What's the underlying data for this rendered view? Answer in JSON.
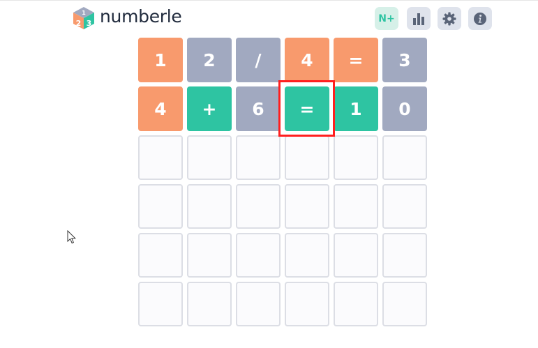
{
  "header": {
    "brand": "numberle",
    "logo_digits": [
      "1",
      "2",
      "3"
    ],
    "buttons": [
      {
        "label": "N+",
        "icon": "n-plus"
      },
      {
        "icon": "bar-chart-icon"
      },
      {
        "icon": "gear-icon"
      },
      {
        "icon": "info-icon"
      }
    ]
  },
  "board": {
    "columns": 6,
    "rows": [
      {
        "tiles": [
          {
            "char": "1",
            "state": "present"
          },
          {
            "char": "2",
            "state": "absent"
          },
          {
            "char": "/",
            "state": "absent"
          },
          {
            "char": "4",
            "state": "present"
          },
          {
            "char": "=",
            "state": "present"
          },
          {
            "char": "3",
            "state": "absent"
          }
        ]
      },
      {
        "tiles": [
          {
            "char": "4",
            "state": "present"
          },
          {
            "char": "+",
            "state": "correct"
          },
          {
            "char": "6",
            "state": "absent"
          },
          {
            "char": "=",
            "state": "correct"
          },
          {
            "char": "1",
            "state": "correct"
          },
          {
            "char": "0",
            "state": "absent"
          }
        ]
      },
      {
        "tiles": [
          {
            "char": "",
            "state": "empty"
          },
          {
            "char": "",
            "state": "empty"
          },
          {
            "char": "",
            "state": "empty"
          },
          {
            "char": "",
            "state": "empty"
          },
          {
            "char": "",
            "state": "empty"
          },
          {
            "char": "",
            "state": "empty"
          }
        ]
      },
      {
        "tiles": [
          {
            "char": "",
            "state": "empty"
          },
          {
            "char": "",
            "state": "empty"
          },
          {
            "char": "",
            "state": "empty"
          },
          {
            "char": "",
            "state": "empty"
          },
          {
            "char": "",
            "state": "empty"
          },
          {
            "char": "",
            "state": "empty"
          }
        ]
      },
      {
        "tiles": [
          {
            "char": "",
            "state": "empty"
          },
          {
            "char": "",
            "state": "empty"
          },
          {
            "char": "",
            "state": "empty"
          },
          {
            "char": "",
            "state": "empty"
          },
          {
            "char": "",
            "state": "empty"
          },
          {
            "char": "",
            "state": "empty"
          }
        ]
      },
      {
        "tiles": [
          {
            "char": "",
            "state": "empty"
          },
          {
            "char": "",
            "state": "empty"
          },
          {
            "char": "",
            "state": "empty"
          },
          {
            "char": "",
            "state": "empty"
          },
          {
            "char": "",
            "state": "empty"
          },
          {
            "char": "",
            "state": "empty"
          }
        ]
      }
    ]
  },
  "colors": {
    "correct": "#2ec4a2",
    "present": "#f89a6d",
    "absent": "#a1a9c0",
    "empty_border": "#dcdee5",
    "highlight": "#ff1f1f"
  },
  "highlighted_tile": {
    "row": 2,
    "column": 4
  }
}
